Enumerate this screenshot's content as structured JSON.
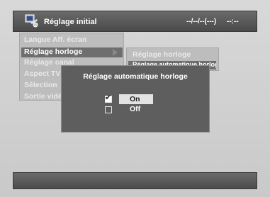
{
  "header": {
    "title": "Réglage initial",
    "datetime": "--/--/--(---)",
    "time": "--:--",
    "icon": "settings-icon"
  },
  "menu": {
    "items": [
      {
        "label": "Langue Aff. écran"
      },
      {
        "label": "Réglage horloge"
      },
      {
        "label": "Réglage canal"
      },
      {
        "label": "Aspect TV"
      },
      {
        "label": "Sélection"
      },
      {
        "label": "Sortie vidéo"
      }
    ]
  },
  "submenu": {
    "items": [
      {
        "label": "Réglage horloge"
      },
      {
        "label": "Réglage automatique horloge"
      }
    ]
  },
  "dialog": {
    "title": "Réglage automatique horloge",
    "options": [
      {
        "label": "On",
        "checked": true
      },
      {
        "label": "Off",
        "checked": false
      }
    ]
  },
  "colors": {
    "background": "#cfcfcf",
    "bar": "#555555",
    "dialog": "#5e5e5e",
    "highlight": "#e3e3e3"
  }
}
